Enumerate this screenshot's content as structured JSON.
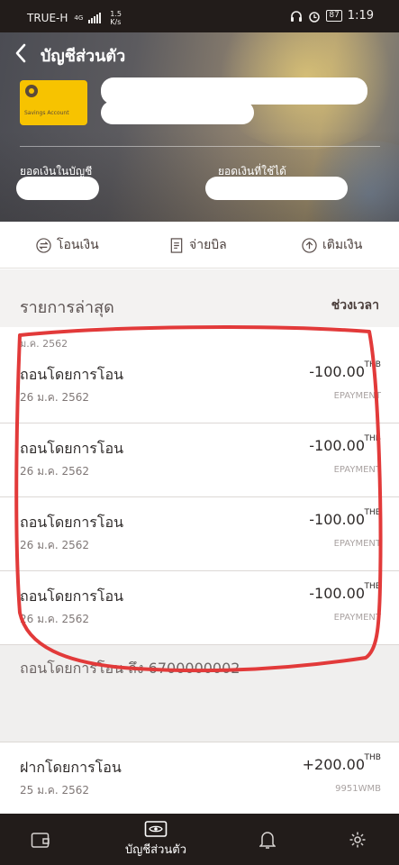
{
  "status_bar": {
    "carrier": "TRUE-H",
    "network": "4G",
    "speed_value": "1.5",
    "speed_unit": "K/s",
    "battery": "87",
    "time": "1:19"
  },
  "header": {
    "title": "บัญชีส่วนตัว",
    "card_label": "Savings Account",
    "balance_label": "ยอดเงินในบัญชี",
    "available_label": "ยอดเงินที่ใช้ได้"
  },
  "actions": [
    {
      "label": "โอนเงิน",
      "icon": "transfer-icon"
    },
    {
      "label": "จ่ายบิล",
      "icon": "bill-icon"
    },
    {
      "label": "เติมเงิน",
      "icon": "topup-icon"
    }
  ],
  "recent": {
    "title": "รายการล่าสุด",
    "period_link": "ช่วงเวลา",
    "date_group": "ม.ค. 2562",
    "transactions": [
      {
        "title": "ถอนโดยการโอน",
        "date": "26 ม.ค. 2562",
        "amount": "-100.00",
        "currency": "THB",
        "ref": "EPAYMENT"
      },
      {
        "title": "ถอนโดยการโอน",
        "date": "26 ม.ค. 2562",
        "amount": "-100.00",
        "currency": "THB",
        "ref": "EPAYMENT"
      },
      {
        "title": "ถอนโดยการโอน",
        "date": "26 ม.ค. 2562",
        "amount": "-100.00",
        "currency": "THB",
        "ref": "EPAYMENT"
      },
      {
        "title": "ถอนโดยการโอน",
        "date": "26 ม.ค. 2562",
        "amount": "-100.00",
        "currency": "THB",
        "ref": "EPAYMENT"
      }
    ],
    "expanded_detail": "ถอนโดยการโอน ถึง 6700000002",
    "last_transaction": {
      "title": "ฝากโดยการโอน",
      "date": "25 ม.ค. 2562",
      "amount": "+200.00",
      "currency": "THB",
      "ref": "9951WMB"
    }
  },
  "bottom_nav": {
    "active_label": "บัญชีส่วนตัว",
    "items": [
      "wallet-icon",
      "eye-card-icon",
      "bell-icon",
      "gear-icon"
    ]
  },
  "colors": {
    "status_bar_bg": "#221c1a",
    "card_yellow": "#f7c300",
    "annotation_red": "#e23a3a",
    "text_dark": "#2e2a29"
  }
}
